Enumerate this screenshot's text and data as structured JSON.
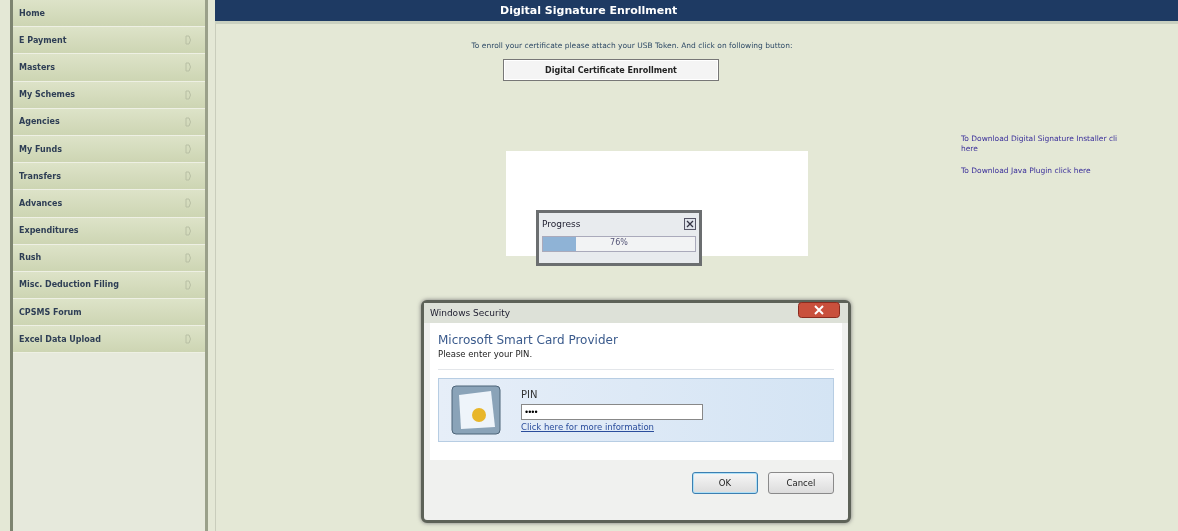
{
  "sidebar": {
    "items": [
      {
        "label": "Home",
        "has_submenu": false
      },
      {
        "label": "E Payment",
        "has_submenu": true
      },
      {
        "label": "Masters",
        "has_submenu": true
      },
      {
        "label": "My Schemes",
        "has_submenu": true
      },
      {
        "label": "Agencies",
        "has_submenu": true
      },
      {
        "label": "My Funds",
        "has_submenu": true
      },
      {
        "label": "Transfers",
        "has_submenu": true
      },
      {
        "label": "Advances",
        "has_submenu": true
      },
      {
        "label": "Expenditures",
        "has_submenu": true
      },
      {
        "label": "Rush",
        "has_submenu": true
      },
      {
        "label": "Misc. Deduction Filing",
        "has_submenu": true
      },
      {
        "label": "CPSMS Forum",
        "has_submenu": false
      },
      {
        "label": "Excel Data Upload",
        "has_submenu": true
      }
    ]
  },
  "page": {
    "title": "Digital Signature Enrollment",
    "instruction": "To enroll your certificate please attach your USB Token. And click on following button:",
    "enroll_button": "Digital Certificate Enrollment",
    "links": [
      {
        "lines": [
          "To Download Digital Signature Installer cli",
          "here"
        ]
      },
      {
        "lines": [
          "To Download Java Plugin click here"
        ]
      }
    ]
  },
  "progress": {
    "title": "Progress",
    "level": 0.22,
    "reading": "76%"
  },
  "security_dialog": {
    "title": "Windows Security",
    "heading": "Microsoft Smart Card Provider",
    "prompt": "Please enter your PIN.",
    "pin_label": "PIN",
    "pin_value": "••••",
    "info_link": "Click here for more information",
    "buttons": [
      "OK",
      "Cancel"
    ]
  }
}
